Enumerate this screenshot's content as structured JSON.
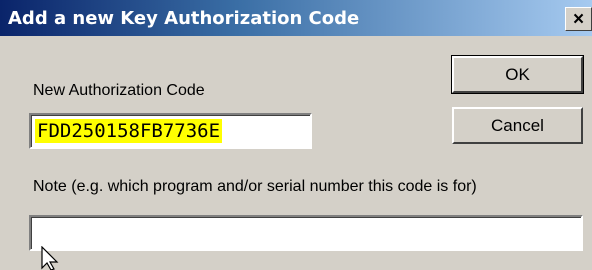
{
  "dialog": {
    "title": "Add a new Key Authorization Code",
    "close_label": "×"
  },
  "form": {
    "code_label": "New Authorization Code",
    "code_value": "FDD250158FB7736E",
    "note_label": "Note (e.g. which program and/or serial number this code is for)",
    "note_value": ""
  },
  "buttons": {
    "ok_label": "OK",
    "cancel_label": "Cancel"
  },
  "colors": {
    "highlight": "#ffff00",
    "titlebar_start": "#0a246a",
    "titlebar_end": "#a6caf0",
    "dialog_bg": "#d4d0c8"
  },
  "icons": {
    "cursor": "mouse-pointer-icon"
  }
}
